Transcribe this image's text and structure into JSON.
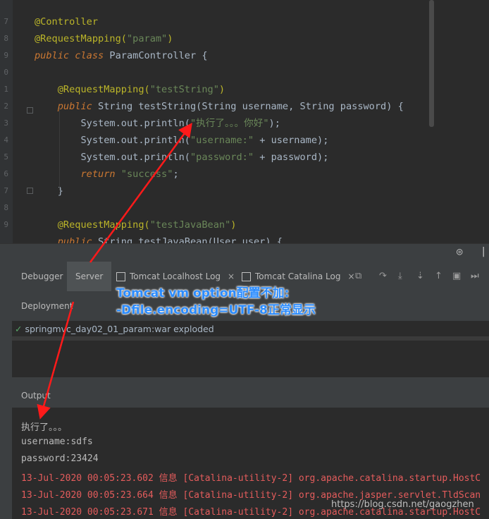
{
  "editor": {
    "line_numbers": [
      "7",
      "8",
      "9",
      "0",
      "1",
      "2",
      "3",
      "4",
      "5",
      "6",
      "7",
      "8",
      "9"
    ],
    "lines": [
      [
        {
          "t": "@Controller",
          "c": "ann"
        }
      ],
      [
        {
          "t": "@RequestMapping(",
          "c": "ann"
        },
        {
          "t": "\"param\"",
          "c": "str"
        },
        {
          "t": ")",
          "c": "ann"
        }
      ],
      [
        {
          "t": "public class ",
          "c": "kw"
        },
        {
          "t": "ParamController {",
          "c": "plain"
        }
      ],
      [],
      [
        {
          "t": "    @RequestMapping(",
          "c": "ann"
        },
        {
          "t": "\"testString\"",
          "c": "str"
        },
        {
          "t": ")",
          "c": "ann"
        }
      ],
      [
        {
          "t": "    public ",
          "c": "kw"
        },
        {
          "t": "String testString(String username, String password) {",
          "c": "plain"
        }
      ],
      [
        {
          "t": "        System.out.println(",
          "c": "plain"
        },
        {
          "t": "\"执行了。。。你好\"",
          "c": "str"
        },
        {
          "t": ");",
          "c": "plain"
        }
      ],
      [
        {
          "t": "        System.out.println(",
          "c": "plain"
        },
        {
          "t": "\"username:\"",
          "c": "str"
        },
        {
          "t": " + username);",
          "c": "plain"
        }
      ],
      [
        {
          "t": "        System.out.println(",
          "c": "plain"
        },
        {
          "t": "\"password:\"",
          "c": "str"
        },
        {
          "t": " + password);",
          "c": "plain"
        }
      ],
      [
        {
          "t": "        return ",
          "c": "kw"
        },
        {
          "t": "\"success\"",
          "c": "str"
        },
        {
          "t": ";",
          "c": "plain"
        }
      ],
      [
        {
          "t": "    }",
          "c": "plain"
        }
      ],
      [],
      [
        {
          "t": "    @RequestMapping(",
          "c": "ann"
        },
        {
          "t": "\"testJavaBean\"",
          "c": "str"
        },
        {
          "t": ")",
          "c": "ann"
        }
      ],
      [
        {
          "t": "    public ",
          "c": "kw"
        },
        {
          "t": "String testJavaBean(User user) {",
          "c": "plain"
        }
      ]
    ]
  },
  "tool_tabs": {
    "debugger": "Debugger",
    "server": "Server",
    "localhost_log": "Tomcat Localhost Log",
    "catalina_log": "Tomcat Catalina Log",
    "close_glyph": "×"
  },
  "deployment": {
    "title": "Deployment",
    "item": "springmvc_day02_01_param:war exploded"
  },
  "output": {
    "title": "Output",
    "lines": [
      {
        "t": "执行了。。。",
        "c": "w"
      },
      {
        "t": "username:sdfs",
        "c": "w"
      },
      {
        "t": "password:23424",
        "c": "w"
      },
      {
        "t": "13-Jul-2020 00:05:23.602 信息 [Catalina-utility-2] org.apache.catalina.startup.HostC",
        "c": "r"
      },
      {
        "t": "13-Jul-2020 00:05:23.664 信息 [Catalina-utility-2] org.apache.jasper.servlet.TldScan",
        "c": "r"
      },
      {
        "t": "13-Jul-2020 00:05:23.671 信息 [Catalina-utility-2] org.apache.catalina.startup.HostC",
        "c": "r"
      }
    ]
  },
  "callout": {
    "line1": "Tomcat vm option配置不加:",
    "line2": "-Dfile.encoding=UTF-8正常显示"
  },
  "watermark": "https://blog.csdn.net/gaogzhen"
}
